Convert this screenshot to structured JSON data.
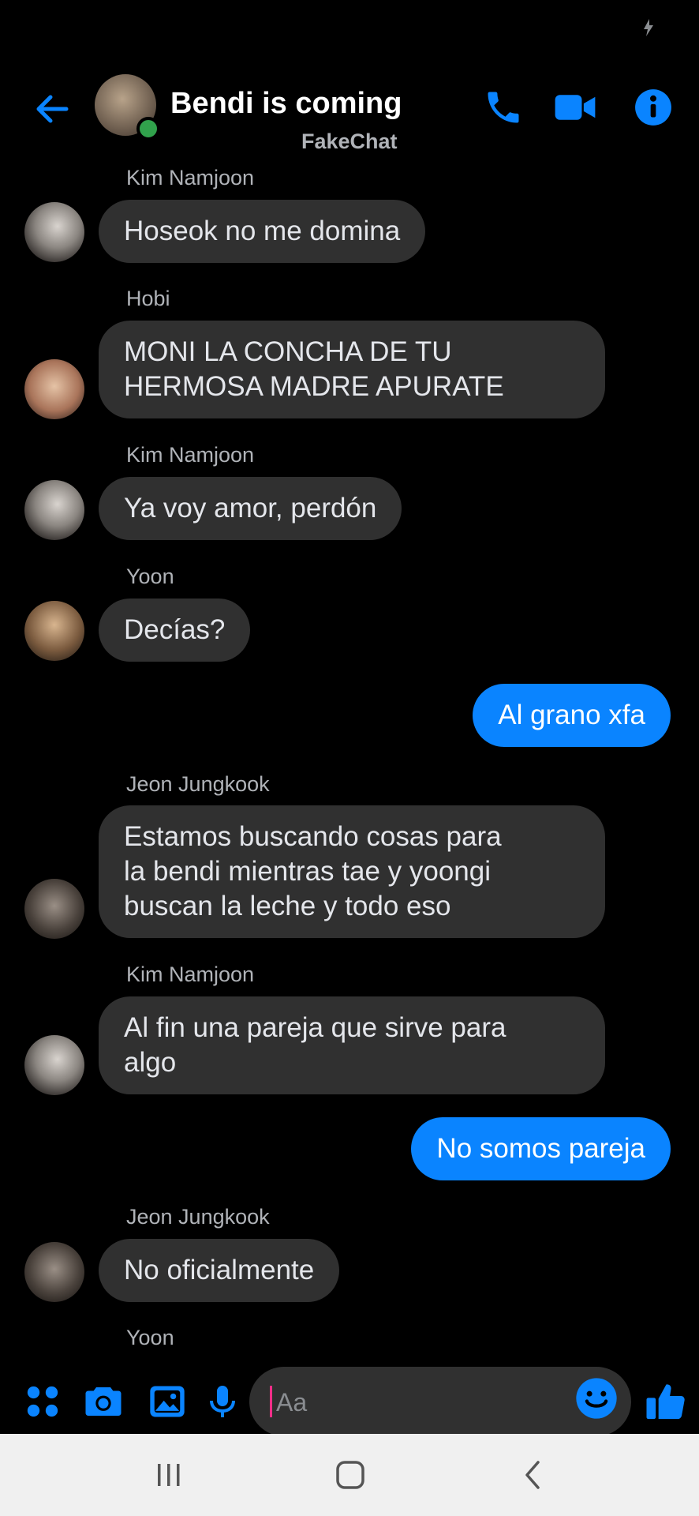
{
  "header": {
    "title": "Bendi is coming",
    "subtitle": "FakeChat",
    "icons": [
      "back-arrow-icon",
      "phone-icon",
      "video-camera-icon",
      "info-icon"
    ],
    "accent_color": "#0a84ff"
  },
  "messages": [
    {
      "sender": "Kim Namjoon",
      "text": "Hoseok no me domina",
      "direction": "in"
    },
    {
      "sender": "Hobi",
      "text": "MONI LA CONCHA DE TU\nHERMOSA MADRE APURATE",
      "direction": "in"
    },
    {
      "sender": "Kim Namjoon",
      "text": "Ya voy amor, perdón",
      "direction": "in"
    },
    {
      "sender": "Yoon",
      "text": "Decías?",
      "direction": "in"
    },
    {
      "sender": "",
      "text": "Al grano xfa",
      "direction": "out"
    },
    {
      "sender": "Jeon Jungkook",
      "text": "Estamos buscando cosas para\nla bendi mientras tae y yoongi\nbuscan la leche y todo eso",
      "direction": "in"
    },
    {
      "sender": "Kim Namjoon",
      "text": "Al fin una pareja que sirve para\nalgo",
      "direction": "in"
    },
    {
      "sender": "",
      "text": "No  somos pareja",
      "direction": "out"
    },
    {
      "sender": "Jeon Jungkook",
      "text": "No oficialmente",
      "direction": "in"
    }
  ],
  "trailing_sender": "Yoon",
  "composer": {
    "placeholder": "Aa",
    "icons": [
      "apps-grid-icon",
      "camera-icon",
      "gallery-icon",
      "microphone-icon",
      "emoji-icon",
      "thumbs-up-icon"
    ]
  },
  "system_nav": {
    "icons": [
      "recent-apps-icon",
      "home-icon",
      "back-icon"
    ]
  }
}
